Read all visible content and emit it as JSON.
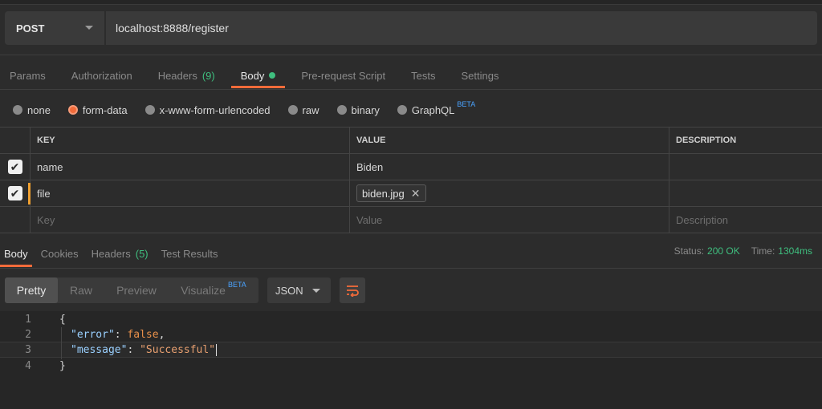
{
  "request": {
    "method": "POST",
    "url": "localhost:8888/register"
  },
  "request_tabs": [
    {
      "label": "Params"
    },
    {
      "label": "Authorization"
    },
    {
      "label": "Headers",
      "count": "(9)"
    },
    {
      "label": "Body"
    },
    {
      "label": "Pre-request Script"
    },
    {
      "label": "Tests"
    },
    {
      "label": "Settings"
    }
  ],
  "body_types": [
    {
      "label": "none",
      "selected": false
    },
    {
      "label": "form-data",
      "selected": true
    },
    {
      "label": "x-www-form-urlencoded",
      "selected": false
    },
    {
      "label": "raw",
      "selected": false
    },
    {
      "label": "binary",
      "selected": false
    },
    {
      "label": "GraphQL",
      "badge": "BETA",
      "selected": false
    }
  ],
  "params_table": {
    "headers": [
      "KEY",
      "VALUE",
      "DESCRIPTION"
    ],
    "rows": [
      {
        "checked": true,
        "key": "name",
        "value": "Biden",
        "description": ""
      },
      {
        "checked": true,
        "key": "file",
        "value": "biden.jpg",
        "description": ""
      }
    ],
    "placeholder": {
      "key": "Key",
      "value": "Value",
      "description": "Description"
    }
  },
  "response_tabs": [
    {
      "label": "Body"
    },
    {
      "label": "Cookies"
    },
    {
      "label": "Headers",
      "count": "(5)"
    },
    {
      "label": "Test Results"
    }
  ],
  "response_status": {
    "status_label": "Status:",
    "status_value": "200 OK",
    "time_label": "Time:",
    "time_value": "1304ms"
  },
  "view_modes": [
    {
      "label": "Pretty"
    },
    {
      "label": "Raw"
    },
    {
      "label": "Preview"
    },
    {
      "label": "Visualize",
      "badge": "BETA"
    }
  ],
  "format": "JSON",
  "code": {
    "line_numbers": [
      "1",
      "2",
      "3",
      "4"
    ],
    "open_brace": "{",
    "close_brace": "}",
    "error_key": "\"error\"",
    "error_value": "false",
    "message_key": "\"message\"",
    "message_value": "\"Successful\""
  },
  "icons": {
    "method_dropdown": "chevron-down-icon",
    "checkbox": "checkmark-icon",
    "remove_file": "close-icon",
    "wrap": "wrap-lines-icon"
  },
  "colors": {
    "accent": "#f26b3a",
    "success": "#3fbf7f",
    "beta": "#4aa3ff"
  }
}
